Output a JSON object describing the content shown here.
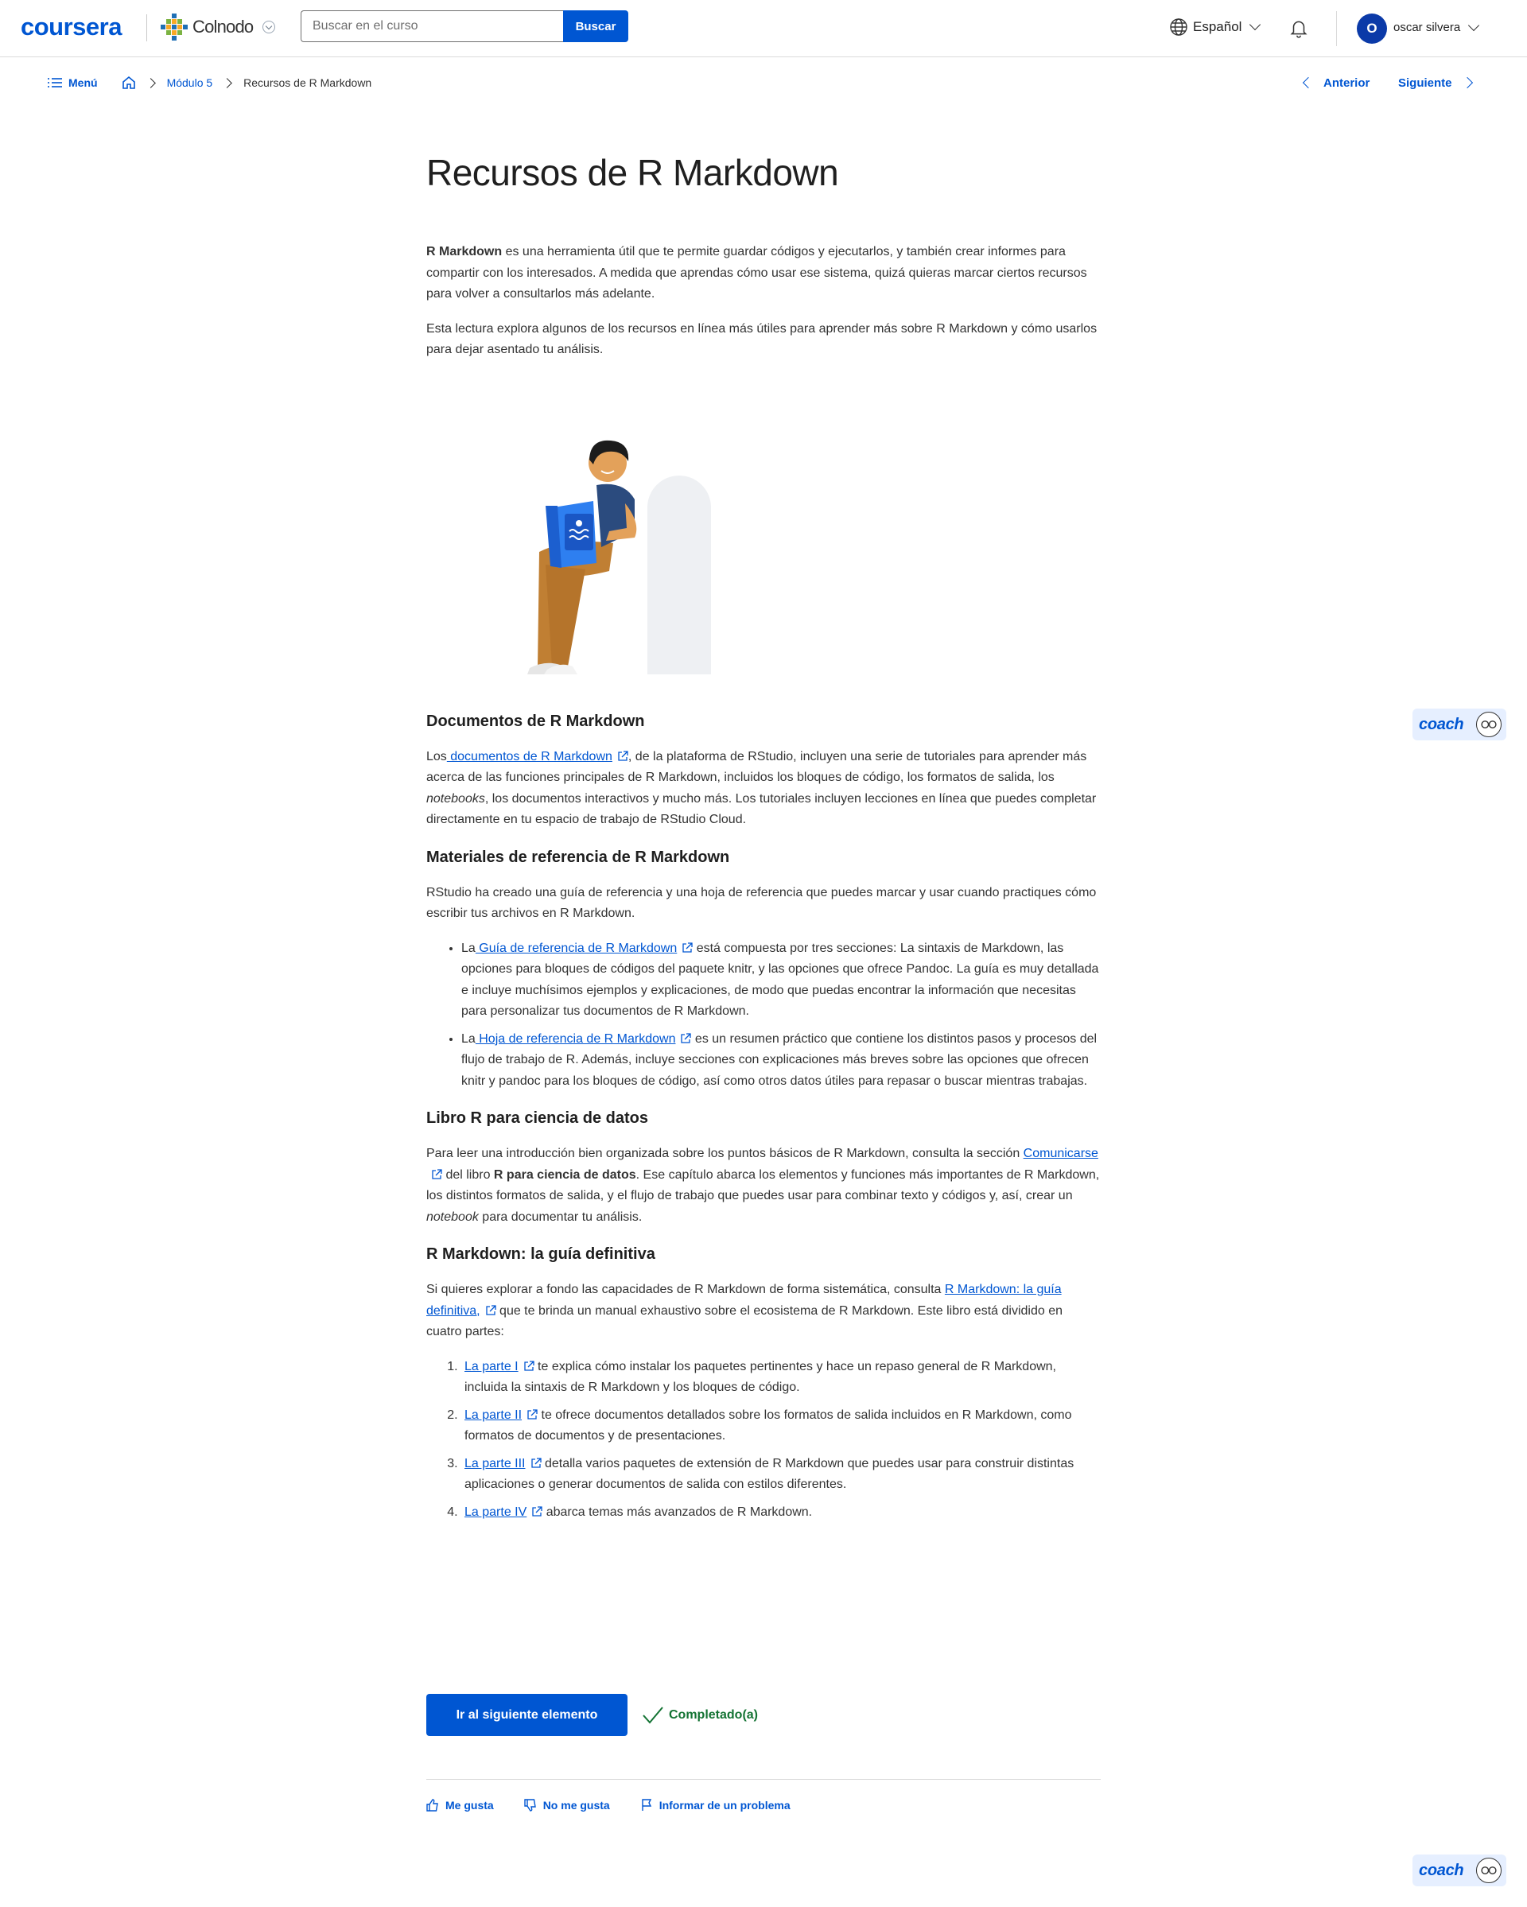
{
  "header": {
    "brand": "coursera",
    "partner_name": "Colnodo",
    "search_placeholder": "Buscar en el curso",
    "search_button": "Buscar",
    "language": "Español",
    "avatar_initial": "O",
    "username": "oscar silvera"
  },
  "breadcrumb": {
    "menu": "Menú",
    "module": "Módulo 5",
    "current": "Recursos de R Markdown",
    "prev": "Anterior",
    "next": "Siguiente"
  },
  "article": {
    "title": "Recursos de R Markdown",
    "intro_bold": "R Markdown",
    "intro_rest": " es una herramienta útil que te permite guardar códigos y ejecutarlos, y también crear informes para compartir con los interesados. A medida que aprendas cómo usar ese sistema, quizá quieras marcar ciertos recursos para volver a consultarlos más adelante.",
    "intro2": "Esta lectura explora algunos de los recursos en línea más útiles para aprender más sobre R Markdown y cómo usarlos para dejar asentado tu análisis.",
    "s1_title": "Documentos de R Markdown",
    "s1_pre": "Los",
    "s1_link": " documentos de R Markdown",
    "s1_mid": ", de la plataforma de RStudio, incluyen una serie de tutoriales para aprender más acerca de las funciones principales de R Markdown, incluidos los bloques de código, los formatos de salida, los ",
    "s1_em": "notebooks",
    "s1_post": ", los documentos interactivos y mucho más. Los tutoriales incluyen lecciones en línea que puedes completar directamente en tu espacio de trabajo de RStudio Cloud.",
    "s2_title": "Materiales de referencia de R Markdown",
    "s2_intro": "RStudio ha creado una guía de referencia y una hoja de referencia que puedes marcar y usar cuando practiques cómo escribir tus archivos en R Markdown.",
    "s2_b1_pre": "La",
    "s2_b1_link": " Guía de referencia de R Markdown",
    "s2_b1_post": " está compuesta por tres secciones: La sintaxis de Markdown, las opciones para bloques de códigos del paquete knitr, y las opciones que ofrece Pandoc. La guía es muy detallada e incluye muchísimos ejemplos y explicaciones, de modo que puedas encontrar la información que necesitas para personalizar tus documentos de R Markdown.",
    "s2_b2_pre": "La",
    "s2_b2_link": " Hoja de referencia de R Markdown",
    "s2_b2_post": " es un resumen práctico que contiene los distintos pasos y procesos del flujo de trabajo de R. Además, incluye secciones con explicaciones más breves sobre las opciones que ofrecen knitr y pandoc para los bloques de código, así como otros datos útiles para repasar o buscar mientras trabajas.",
    "s3_title": "Libro R para ciencia de datos",
    "s3_pre": "Para leer una introducción bien organizada sobre los puntos básicos de R Markdown, consulta la sección ",
    "s3_link": " Comunicarse",
    "s3_mid": " del libro ",
    "s3_bold": "R para ciencia de datos",
    "s3_mid2": ". Ese capítulo abarca los elementos y funciones más importantes de R Markdown, los distintos formatos de salida, y el flujo de trabajo que puedes usar para combinar texto y códigos y, así, crear un ",
    "s3_em": "notebook",
    "s3_post": " para documentar tu análisis.",
    "s4_title": "R Markdown: la guía definitiva",
    "s4_pre": "Si quieres explorar a fondo las capacidades de R Markdown de forma sistemática, consulta ",
    "s4_link": " R Markdown: la guía definitiva,",
    "s4_post": " que te brinda un manual exhaustivo sobre el ecosistema de R Markdown. Este libro está dividido en cuatro partes:",
    "parts": [
      {
        "link": "La parte I",
        "text": " te explica cómo instalar los paquetes pertinentes y hace un repaso general de R Markdown, incluida la sintaxis de R Markdown y los bloques de código."
      },
      {
        "link": "La parte II",
        "text": " te ofrece documentos detallados sobre los formatos de salida incluidos en R Markdown, como formatos de documentos y de presentaciones."
      },
      {
        "link": "La parte III",
        "text": " detalla varios paquetes de extensión de R Markdown que puedes usar para construir distintas aplicaciones o generar documentos de salida con estilos diferentes."
      },
      {
        "link": "La parte IV",
        "text": " abarca temas más avanzados de R Markdown."
      }
    ]
  },
  "footer": {
    "next_button": "Ir al siguiente elemento",
    "completed": "Completado(a)",
    "like": "Me gusta",
    "dislike": "No me gusta",
    "report": "Informar de un problema"
  },
  "coach": {
    "label": "coach"
  },
  "colors": {
    "brand": "#0056d2",
    "success": "#137333",
    "avatar": "#0b3aa8"
  }
}
